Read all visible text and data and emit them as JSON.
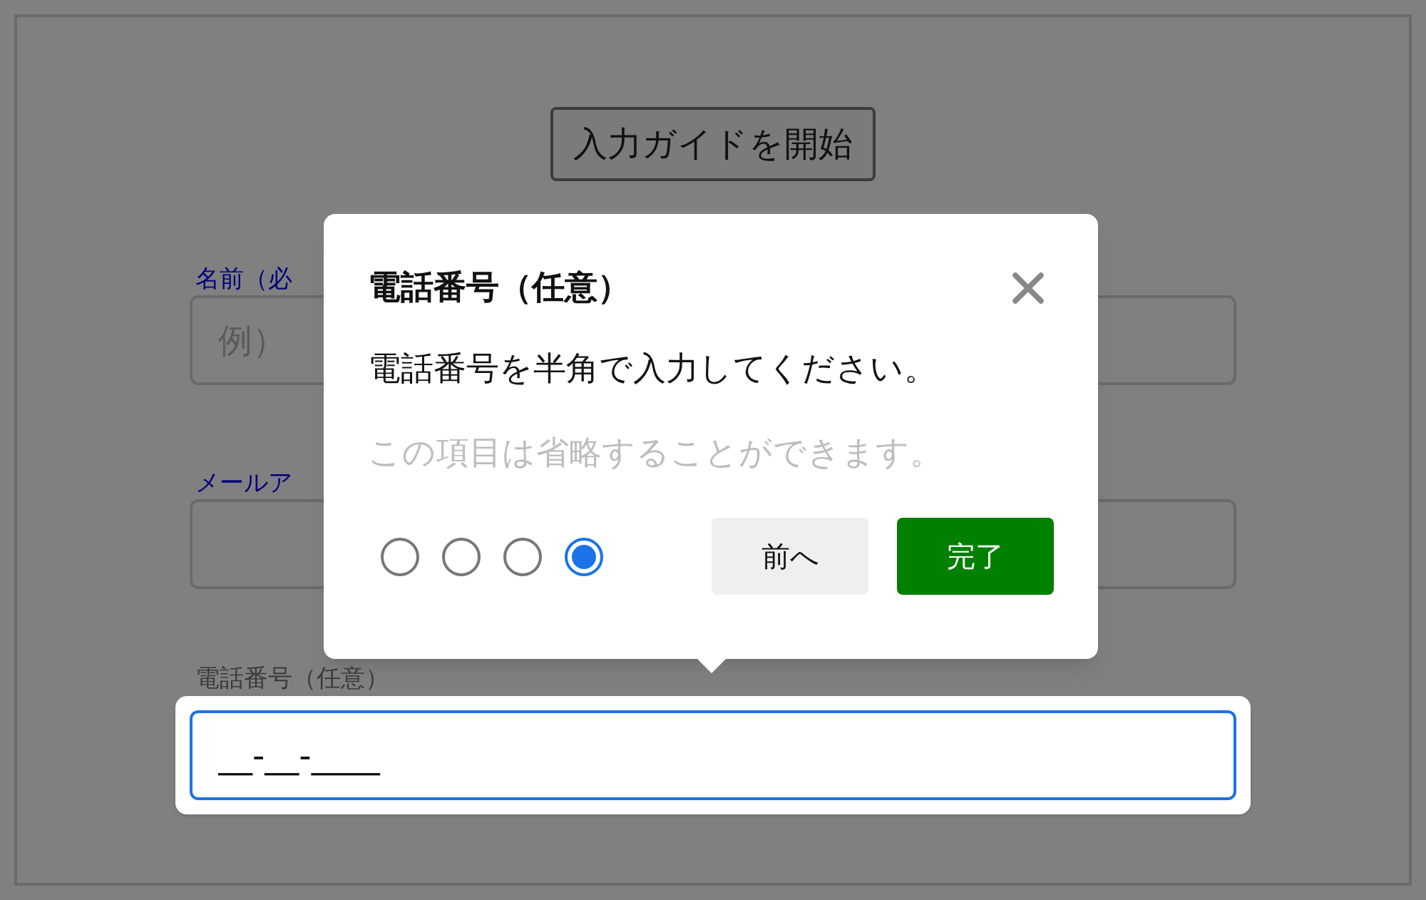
{
  "start_button": {
    "label": "入力ガイドを開始"
  },
  "fields": [
    {
      "label": "名前（必",
      "placeholder": "例）",
      "highlighted": false
    },
    {
      "label": "メールア",
      "highlighted": false
    },
    {
      "label": "電話番号（任意）",
      "value": "__-__-____",
      "highlighted": true
    }
  ],
  "guide": {
    "title": "電話番号（任意）",
    "message": "電話番号を半角で入力してください。",
    "note": "この項目は省略することができます。",
    "steps": [
      {
        "selected": false
      },
      {
        "selected": false
      },
      {
        "selected": false
      },
      {
        "selected": true
      }
    ],
    "prev_button": "前へ",
    "finish_button": "完了"
  }
}
